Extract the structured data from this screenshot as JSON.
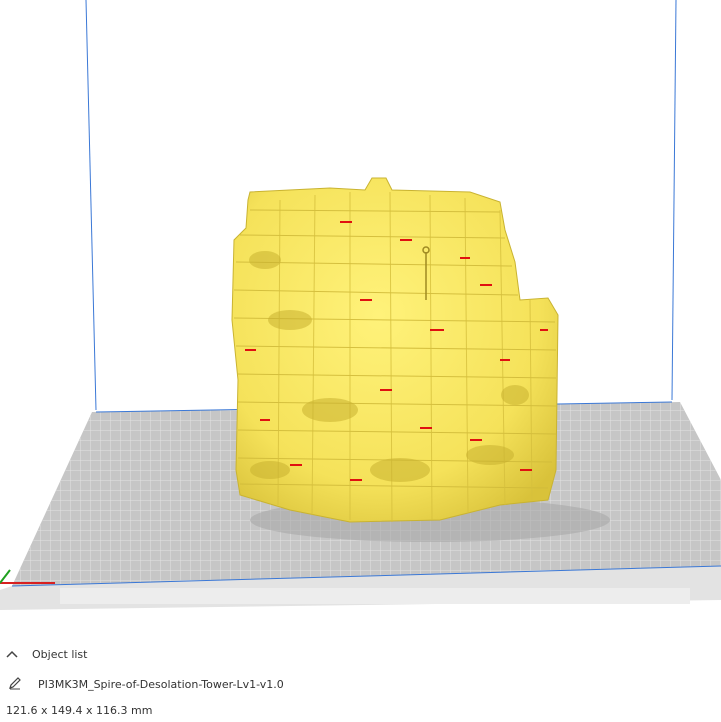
{
  "object_list": {
    "header_label": "Object list",
    "collapse_icon": "chevron-up-icon",
    "edit_icon": "pencil-icon",
    "object_name": "PI3MK3M_Spire-of-Desolation-Tower-Lv1-v1.0",
    "dimensions": "121.6 x 149.4 x 116.3 mm"
  },
  "colors": {
    "model": "#f5e560",
    "model_shadow": "#d6c23a",
    "overhang": "#e01010",
    "build_plate": "#c8c8c8",
    "grid_line": "#e6e6e6",
    "volume_edge": "#3b78d6",
    "background": "#ffffff"
  }
}
